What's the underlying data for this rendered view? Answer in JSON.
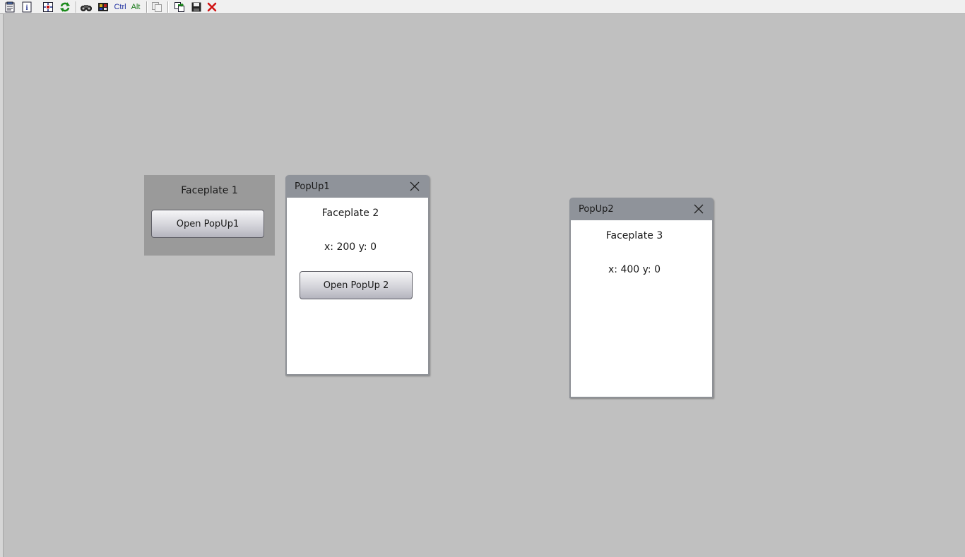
{
  "toolbar": {
    "items": [
      {
        "name": "properties-icon"
      },
      {
        "name": "info-icon"
      },
      {
        "name": "select-objects-icon"
      },
      {
        "name": "refresh-icon"
      },
      {
        "name": "binoculars-icon"
      },
      {
        "name": "display-icon"
      },
      {
        "ctrl_label": "Ctrl",
        "alt_label": "Alt"
      },
      {
        "name": "copy-icon"
      },
      {
        "name": "export-icon"
      },
      {
        "name": "save-icon"
      },
      {
        "name": "close-icon"
      }
    ],
    "ctrl_label": "Ctrl",
    "alt_label": "Alt"
  },
  "faceplate1": {
    "title": "Faceplate 1",
    "button_label": "Open PopUp1"
  },
  "popup1": {
    "title": "PopUp1",
    "faceplate_title": "Faceplate 2",
    "coords": "x: 200 y: 0",
    "button_label": "Open PopUp 2"
  },
  "popup2": {
    "title": "PopUp2",
    "faceplate_title": "Faceplate 3",
    "coords": "x: 400 y: 0"
  },
  "colors": {
    "background": "#c0c0c0",
    "popup_header": "#8f939a",
    "faceplate_bg": "#9a9a9a",
    "ctrl_text": "#1f2fa0",
    "alt_text": "#1a7a1a",
    "close_red": "#d01010"
  }
}
